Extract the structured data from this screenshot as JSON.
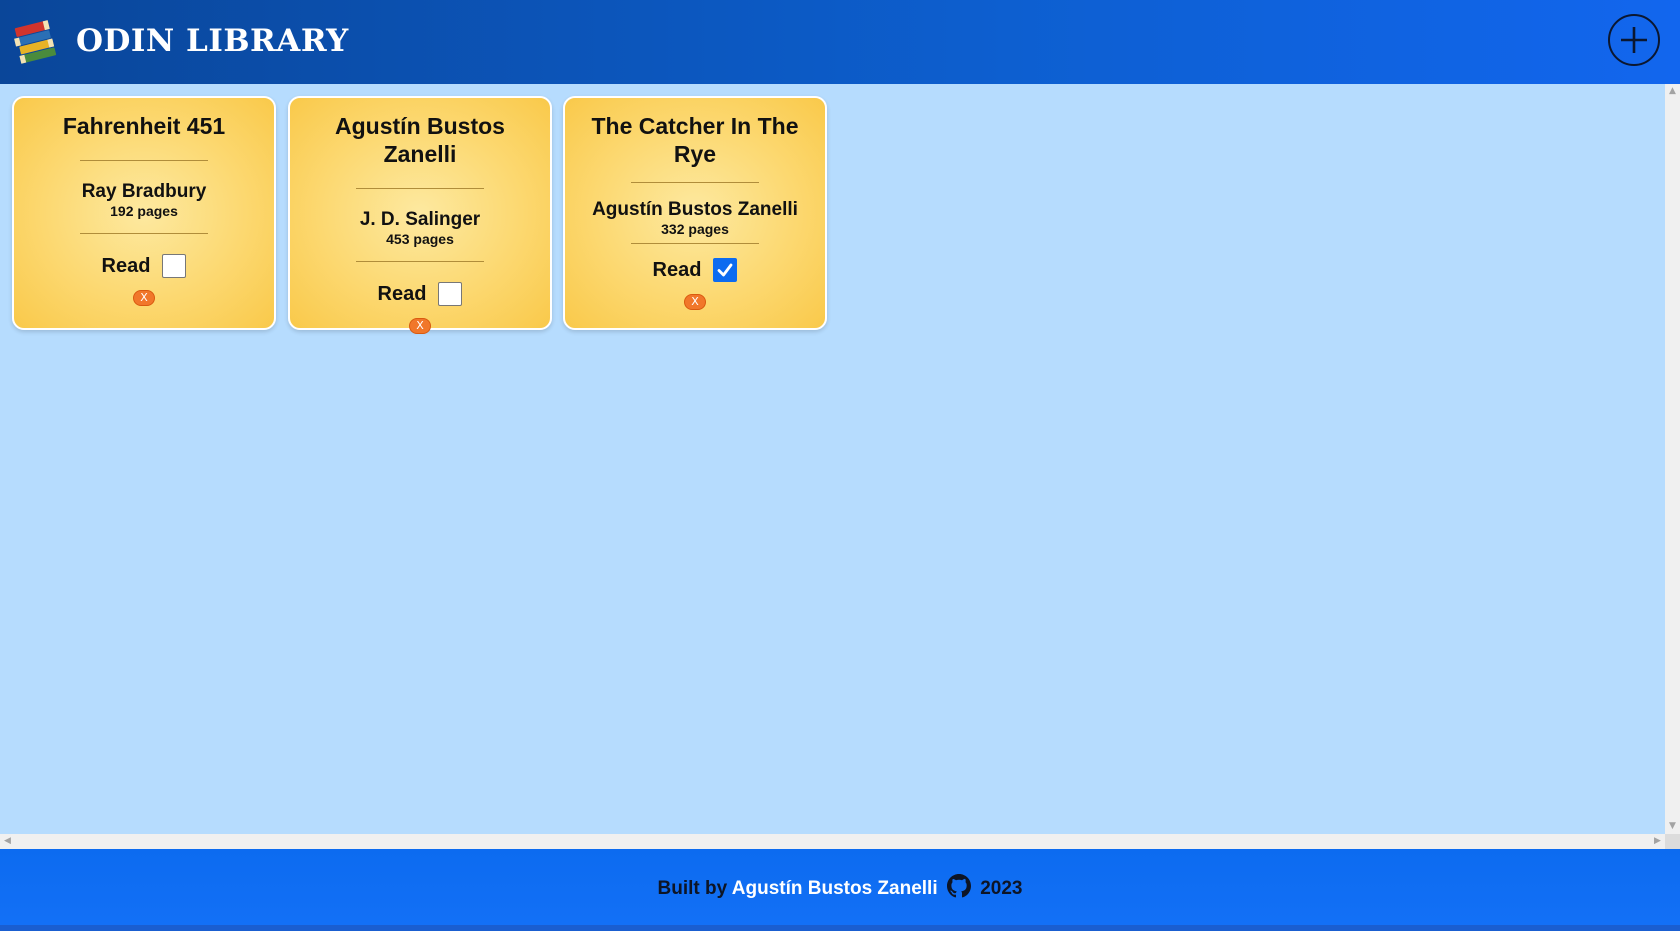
{
  "header": {
    "brand": "ODIN LIBRARY",
    "logo_icon": "books-stack-icon",
    "add_button_icon": "plus-icon"
  },
  "books": [
    {
      "title": "Fahrenheit 451",
      "author": "Ray Bradbury",
      "pages": "192 pages",
      "read_label": "Read",
      "read": false,
      "remove_label": "X"
    },
    {
      "title": "Agustín Bustos Zanelli",
      "author": "J. D. Salinger",
      "pages": "453 pages",
      "read_label": "Read",
      "read": false,
      "remove_label": "X"
    },
    {
      "title": "The Catcher In The Rye",
      "author": "Agustín Bustos Zanelli",
      "pages": "332 pages",
      "read_label": "Read",
      "read": true,
      "remove_label": "X"
    }
  ],
  "footer": {
    "prefix": "Built by",
    "author": "Agustín Bustos Zanelli",
    "github_icon": "github-icon",
    "year": "2023"
  },
  "colors": {
    "header_dark": "#0a4699",
    "header_light": "#1266ee",
    "background": "#b6dcfe",
    "card": "#fcd870",
    "checkbox_checked": "#0c6bf0",
    "remove_button": "#f1772a"
  }
}
